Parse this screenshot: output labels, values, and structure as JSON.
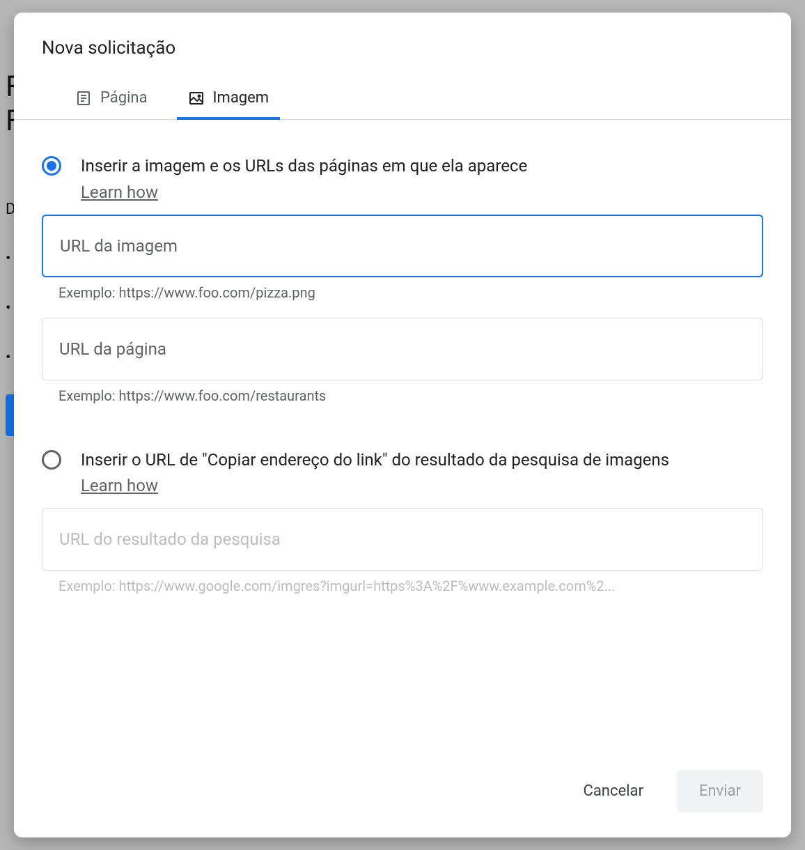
{
  "backdrop": {
    "letter1": "F",
    "letter2": "F",
    "d": "D"
  },
  "dialog": {
    "title": "Nova solicitação",
    "tabs": {
      "page": "Página",
      "image": "Imagem"
    },
    "option1": {
      "title": "Inserir a imagem e os URLs das páginas em que ela aparece",
      "learn": "Learn how",
      "input_image_placeholder": "URL da imagem",
      "input_image_helper": "Exemplo: https://www.foo.com/pizza.png",
      "input_page_placeholder": "URL da página",
      "input_page_helper": "Exemplo: https://www.foo.com/restaurants"
    },
    "option2": {
      "title": "Inserir o URL de \"Copiar endereço do link\" do resultado da pesquisa de imagens",
      "learn": "Learn how",
      "input_placeholder": "URL do resultado da pesquisa",
      "input_helper": "Exemplo: https://www.google.com/imgres?imgurl=https%3A%2F%www.example.com%2..."
    },
    "footer": {
      "cancel": "Cancelar",
      "submit": "Enviar"
    }
  }
}
